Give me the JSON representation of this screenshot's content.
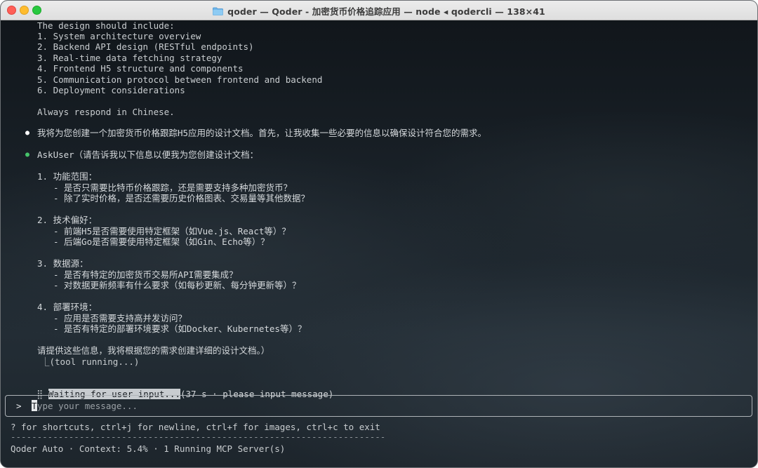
{
  "window": {
    "title": "qoder — Qoder - 加密货币价格追踪应用 — node ◂ qodercli — 138×41"
  },
  "transcript": {
    "design_intro": "The design should include:",
    "design_items": [
      "1. System architecture overview",
      "2. Backend API design (RESTful endpoints)",
      "3. Real-time data fetching strategy",
      "4. Frontend H5 structure and components",
      "5. Communication protocol between frontend and backend",
      "6. Deployment considerations"
    ],
    "language_note": "Always respond in Chinese.",
    "assistant_bullet": "●",
    "assistant_message": "我将为您创建一个加密货币价格跟踪H5应用的设计文档。首先，让我收集一些必要的信息以确保设计符合您的需求。",
    "tool_bullet": "●",
    "tool_call": "AskUser（请告诉我以下信息以便我为您创建设计文档：",
    "questions": [
      {
        "heading": "1. 功能范围：",
        "items": [
          "- 是否只需要比特币价格跟踪，还是需要支持多种加密货币？",
          "- 除了实时价格，是否还需要历史价格图表、交易量等其他数据？"
        ]
      },
      {
        "heading": "2. 技术偏好：",
        "items": [
          "- 前端H5是否需要使用特定框架（如Vue.js、React等）？",
          "- 后端Go是否需要使用特定框架（如Gin、Echo等）？"
        ]
      },
      {
        "heading": "3. 数据源：",
        "items": [
          "- 是否有特定的加密货币交易所API需要集成？",
          "- 对数据更新频率有什么要求（如每秒更新、每分钟更新等）？"
        ]
      },
      {
        "heading": "4. 部署环境：",
        "items": [
          "- 应用是否需要支持高并发访问？",
          "- 是否有特定的部署环境要求（如Docker、Kubernetes等）？"
        ]
      }
    ],
    "closing": "请提供这些信息，我将根据您的需求创建详细的设计文档。）",
    "tool_status": "⎿(tool running...)"
  },
  "status": {
    "grip": "⣿",
    "waiting": "Waiting for user input...",
    "waiting_detail": "(37 s · please input message)"
  },
  "input": {
    "prompt": ">",
    "cursor_char": "T",
    "placeholder": "ype your message..."
  },
  "footer": {
    "shortcuts": "? for shortcuts, ctrl+j for newline, ctrl+f for images, ctrl+c to exit",
    "divider": "-----------------------------------------------------------------------",
    "info": "Qoder Auto · Context: 5.4% · 1 Running MCP Server(s)"
  }
}
